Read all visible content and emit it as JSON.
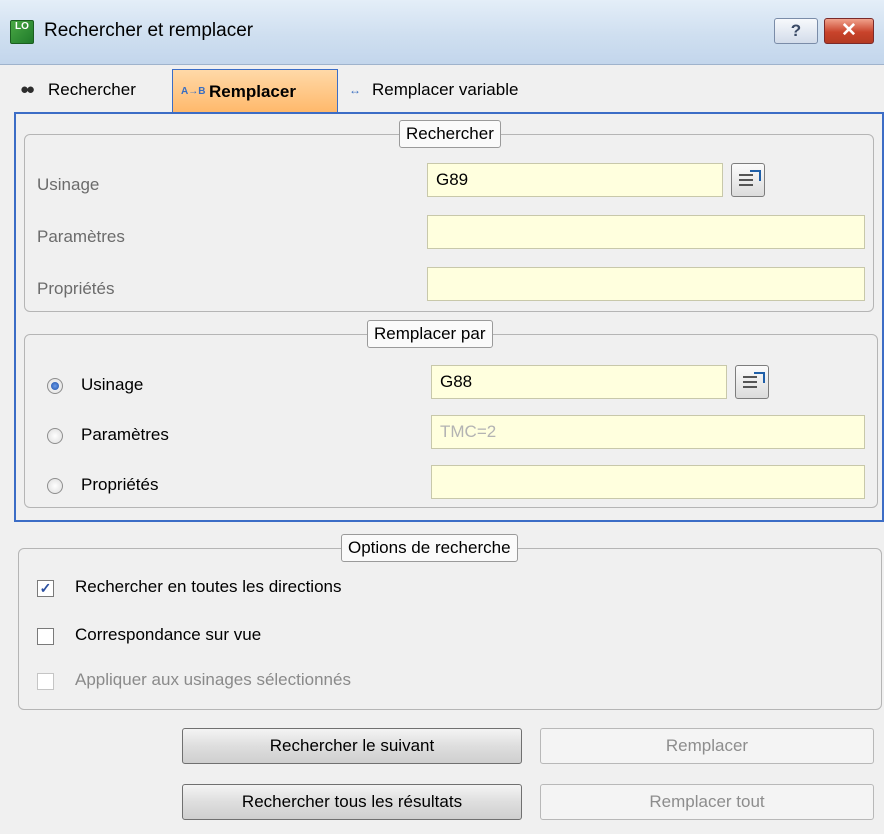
{
  "window": {
    "title": "Rechercher et remplacer",
    "app_icon_text": "LO",
    "help_label": "?",
    "close_label": "✕"
  },
  "tabs": [
    {
      "label": "Rechercher",
      "icon": "binoculars-icon",
      "active": false
    },
    {
      "label": "Remplacer",
      "icon": "replace-ab-icon",
      "icon_glyph": "A→B",
      "active": true
    },
    {
      "label": "Remplacer variable",
      "icon": "replace-variable-icon",
      "icon_glyph": "↔",
      "active": false
    }
  ],
  "search_group": {
    "legend": "Rechercher",
    "rows": [
      {
        "label": "Usinage",
        "value": "G89"
      },
      {
        "label": "Paramètres",
        "value": ""
      },
      {
        "label": "Propriétés",
        "value": ""
      }
    ]
  },
  "replace_group": {
    "legend": "Remplacer par",
    "rows": [
      {
        "label": "Usinage",
        "value": "G88",
        "selected": true
      },
      {
        "label": "Paramètres",
        "value": "",
        "placeholder": "TMC=2",
        "selected": false
      },
      {
        "label": "Propriétés",
        "value": "",
        "selected": false
      }
    ]
  },
  "options_group": {
    "legend": "Options de recherche",
    "options": [
      {
        "label": "Rechercher  en toutes les directions",
        "checked": true,
        "enabled": true
      },
      {
        "label": "Correspondance sur vue",
        "checked": false,
        "enabled": true
      },
      {
        "label": "Appliquer aux usinages sélectionnés",
        "checked": false,
        "enabled": false
      }
    ]
  },
  "buttons": {
    "find_next": "Rechercher le suivant",
    "replace": "Remplacer",
    "find_all": "Rechercher tous les résultats",
    "replace_all": "Remplacer tout"
  },
  "colors": {
    "active_tab": "#ffb86a",
    "tab_border": "#3c6dc6",
    "field_background": "#ffffde",
    "close_button": "#c9432b"
  }
}
